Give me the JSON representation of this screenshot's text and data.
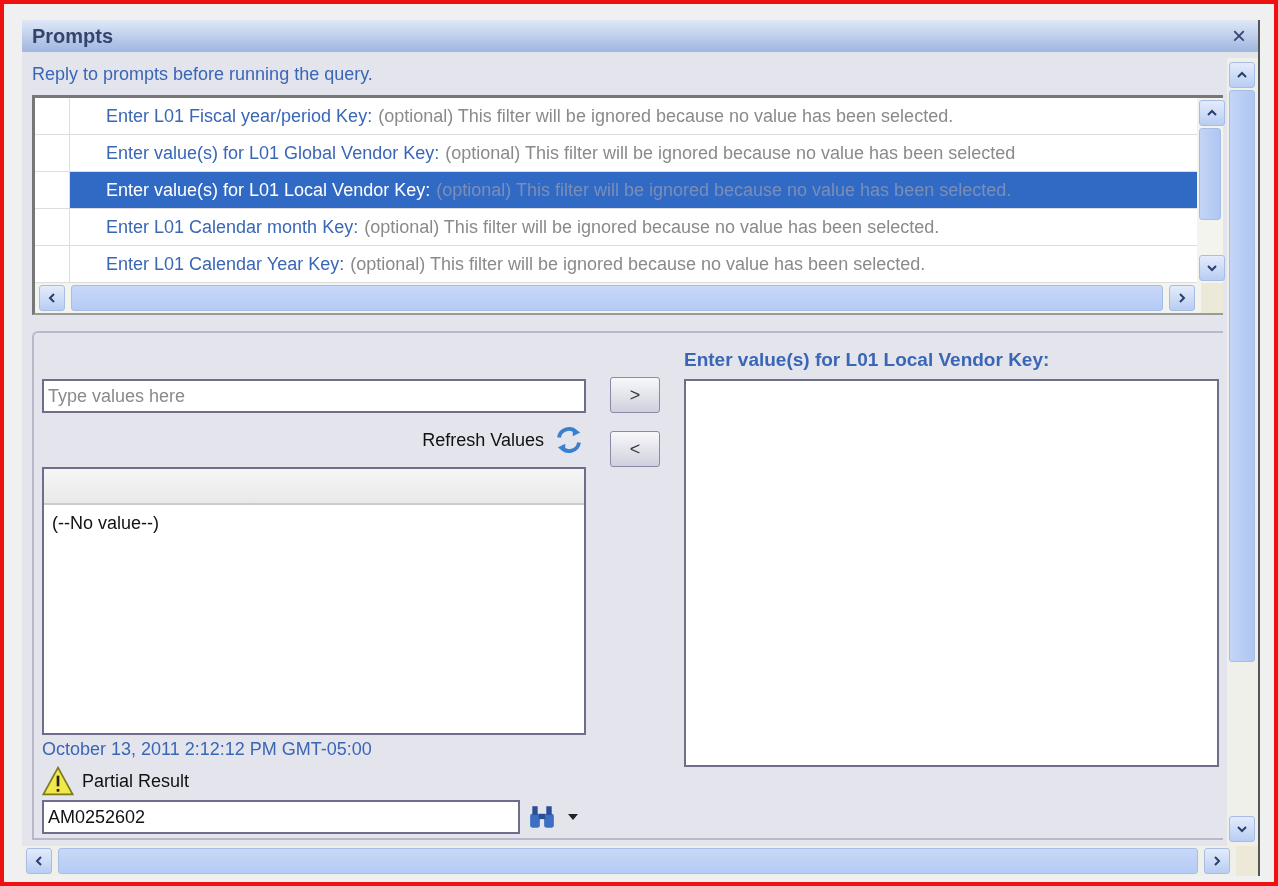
{
  "window": {
    "title": "Prompts",
    "close": "×"
  },
  "instruction": "Reply to prompts before running the query.",
  "prompts": [
    {
      "label": "Enter L01 Fiscal year/period Key:",
      "note": "(optional) This filter will be ignored because no value has been selected.",
      "selected": false
    },
    {
      "label": "Enter value(s) for L01 Global Vendor Key:",
      "note": "(optional) This filter will be ignored because no value has been selected",
      "selected": false
    },
    {
      "label": "Enter value(s) for L01 Local Vendor Key:",
      "note": "(optional) This filter will be ignored because no value has been selected.",
      "selected": true
    },
    {
      "label": "Enter L01 Calendar month Key:",
      "note": "(optional) This filter will be ignored because no value has been selected.",
      "selected": false
    },
    {
      "label": "Enter L01 Calendar Year Key:",
      "note": "(optional) This filter will be ignored because no value has been selected.",
      "selected": false
    }
  ],
  "value_entry": {
    "placeholder": "Type values here",
    "refresh_label": "Refresh Values",
    "values": [
      "(--No value--)"
    ],
    "timestamp": "October 13, 2011 2:12:12 PM GMT-05:00",
    "warning": "Partial Result",
    "search_value": "AM0252602"
  },
  "move_buttons": [
    ">",
    "<"
  ],
  "selected_heading": "Enter value(s) for L01 Local Vendor Key:"
}
